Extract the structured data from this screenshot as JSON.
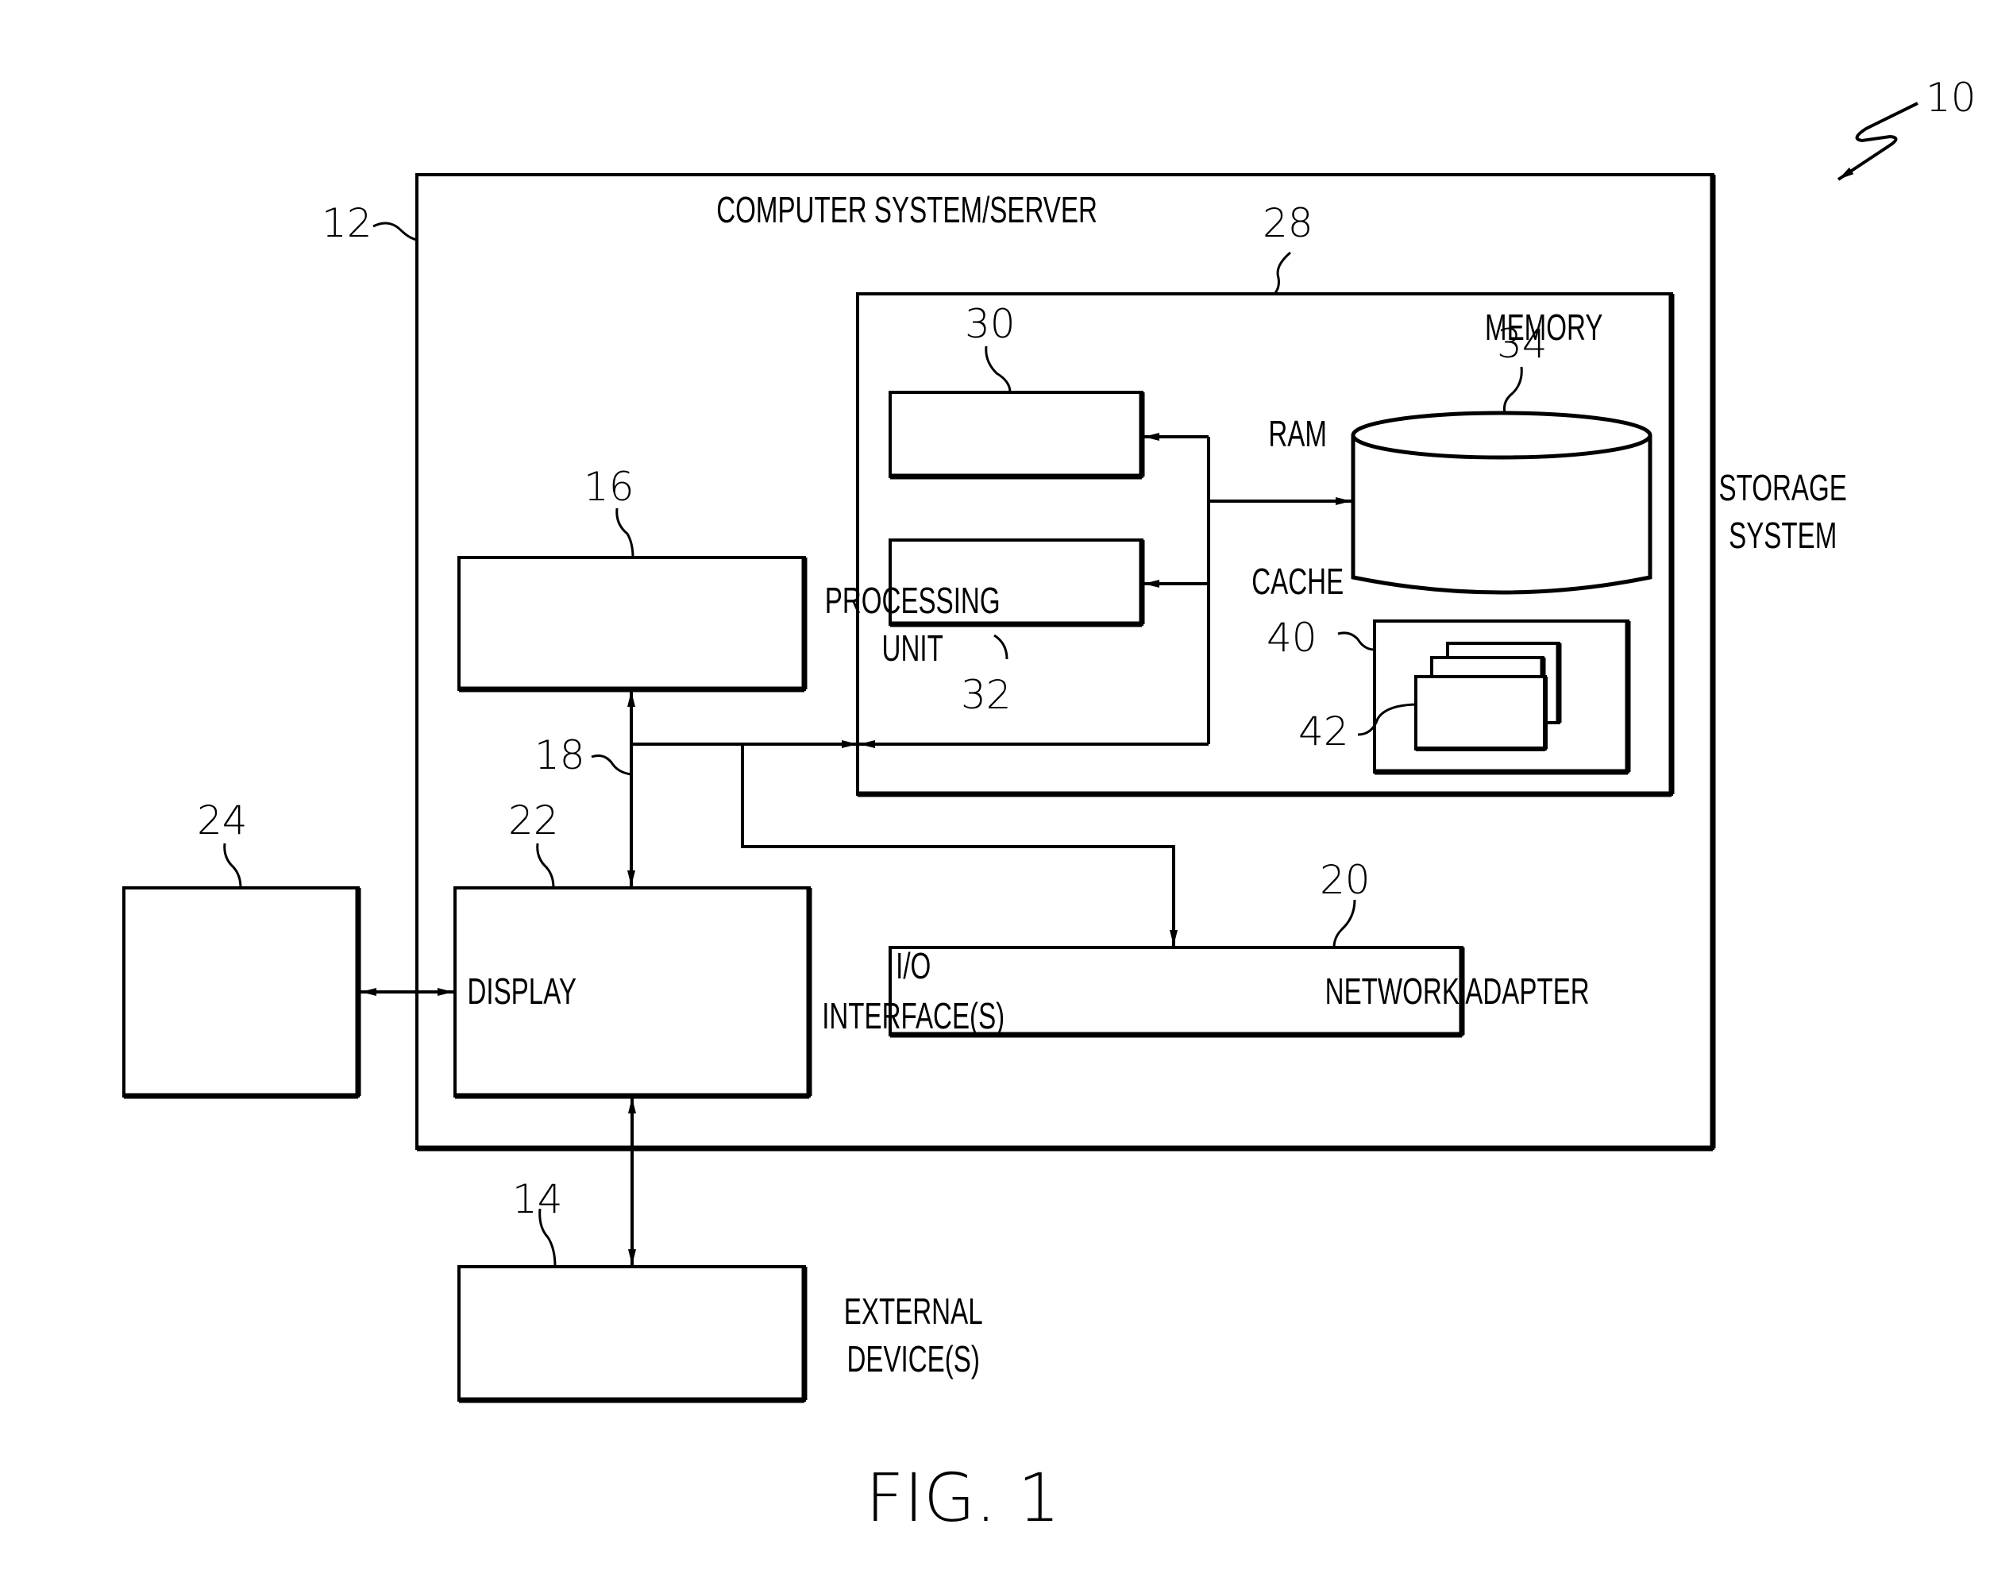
{
  "figure": {
    "caption": "FIG. 1",
    "system_ref": "10"
  },
  "computer_system": {
    "title": "COMPUTER SYSTEM/SERVER",
    "ref": "12"
  },
  "memory": {
    "title": "MEMORY",
    "ref": "28",
    "ram": {
      "label": "RAM",
      "ref": "30"
    },
    "cache": {
      "label": "CACHE",
      "ref": "32"
    },
    "storage": {
      "line1": "STORAGE",
      "line2": "SYSTEM",
      "ref": "34"
    },
    "program_utility": {
      "ref": "40"
    },
    "program_modules": {
      "ref": "42"
    }
  },
  "processing_unit": {
    "line1": "PROCESSING",
    "line2": "UNIT",
    "ref": "16"
  },
  "bus": {
    "ref": "18"
  },
  "io_interface": {
    "line1": "I/O",
    "line2": "INTERFACE(S)",
    "ref": "22"
  },
  "display": {
    "label": "DISPLAY",
    "ref": "24"
  },
  "network_adapter": {
    "label": "NETWORK ADAPTER",
    "ref": "20"
  },
  "external_devices": {
    "line1": "EXTERNAL",
    "line2": "DEVICE(S)",
    "ref": "14"
  }
}
